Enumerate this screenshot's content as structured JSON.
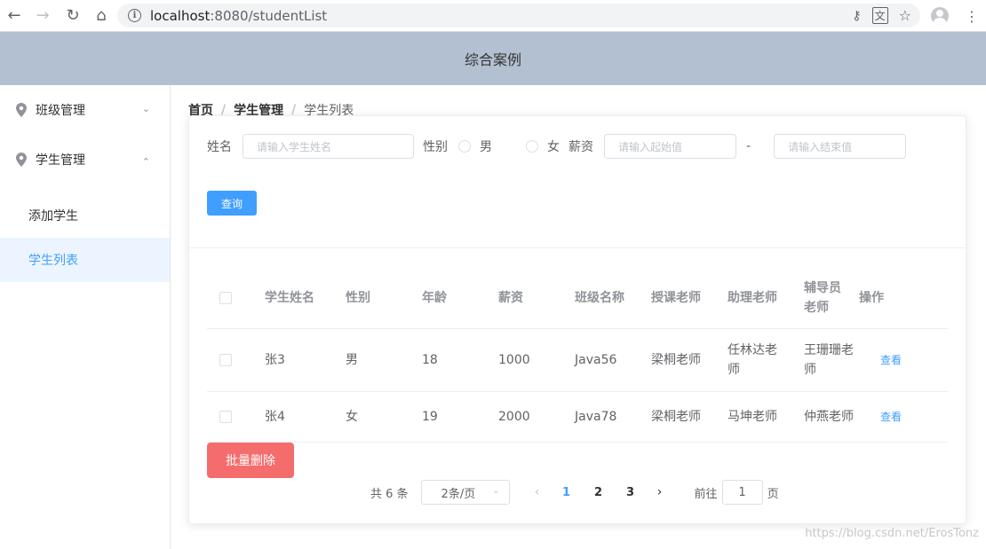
{
  "browser": {
    "url_host": "localhost",
    "url_rest": ":8080/studentList"
  },
  "header": {
    "title": "综合案例"
  },
  "sidebar": {
    "menus": [
      {
        "label": "班级管理"
      },
      {
        "label": "学生管理"
      }
    ],
    "sub_items": [
      {
        "label": "添加学生"
      },
      {
        "label": "学生列表"
      }
    ]
  },
  "breadcrumb": {
    "home": "首页",
    "section": "学生管理",
    "current": "学生列表"
  },
  "search": {
    "name_label": "姓名",
    "name_placeholder": "请输入学生姓名",
    "gender_label": "性别",
    "gender_male": "男",
    "gender_female": "女",
    "salary_label": "薪资",
    "salary_start_placeholder": "请输入起始值",
    "range_sep": "-",
    "salary_end_placeholder": "请输入结束值",
    "query_button": "查询"
  },
  "table": {
    "headers": [
      "学生姓名",
      "性别",
      "年龄",
      "薪资",
      "班级名称",
      "授课老师",
      "助理老师",
      "辅导员老师",
      "操作"
    ],
    "rows": [
      {
        "name": "张3",
        "gender": "男",
        "age": "18",
        "salary": "1000",
        "class": "Java56",
        "teacher": "梁桐老师",
        "assistant": "任林达老师",
        "counselor": "王珊珊老师",
        "action": "查看"
      },
      {
        "name": "张4",
        "gender": "女",
        "age": "19",
        "salary": "2000",
        "class": "Java78",
        "teacher": "梁桐老师",
        "assistant": "马坤老师",
        "counselor": "仲燕老师",
        "action": "查看"
      }
    ]
  },
  "batch_delete": "批量删除",
  "pagination": {
    "total": "共 6 条",
    "page_size": "2条/页",
    "pages": [
      "1",
      "2",
      "3"
    ],
    "goto_label": "前往",
    "goto_value": "1",
    "page_suffix": "页"
  },
  "watermark": "https://blog.csdn.net/ErosTonz",
  "colors": {
    "primary": "#409eff",
    "danger": "#f56c6c",
    "header_bg": "#b3c0d1"
  }
}
